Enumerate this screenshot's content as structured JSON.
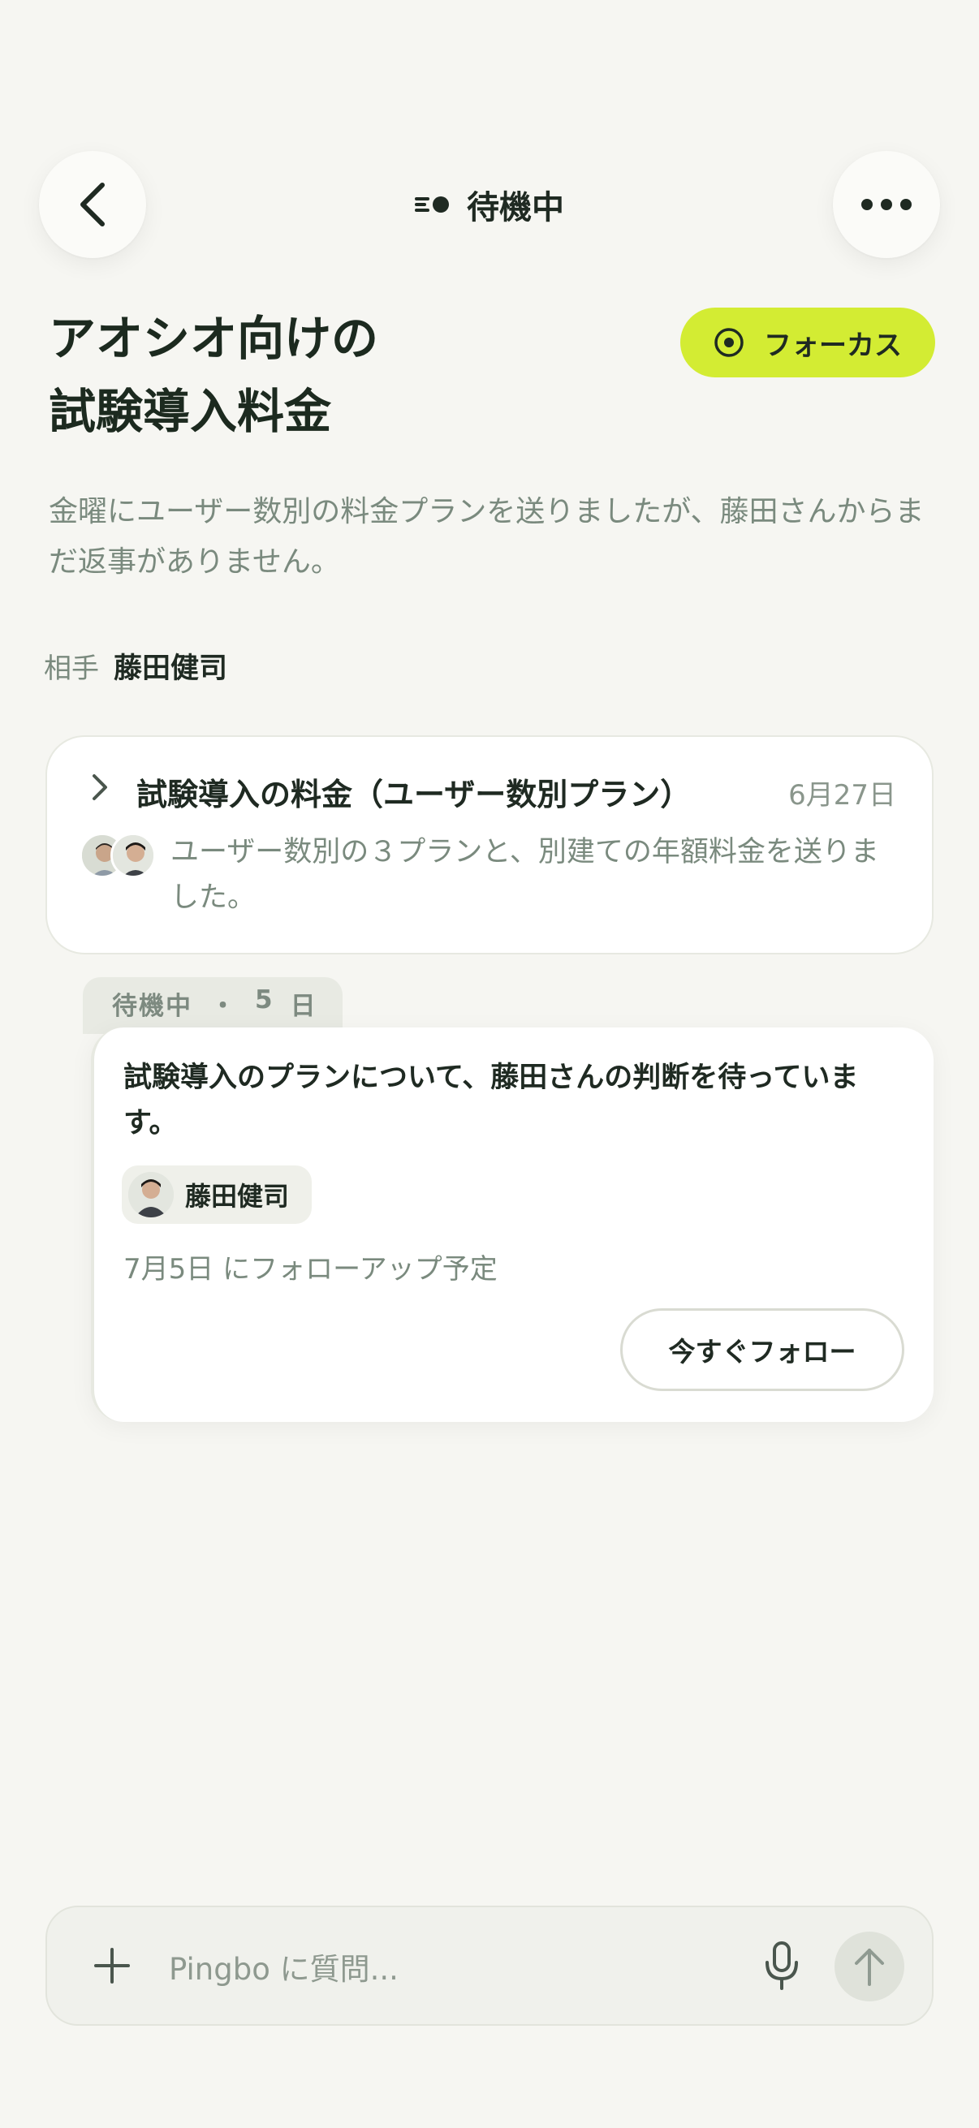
{
  "header": {
    "status_label": "待機中"
  },
  "page": {
    "title_line1": "アオシオ向けの",
    "title_line2": "試験導入料金",
    "focus_label": "フォーカス",
    "description": "金曜にユーザー数別の料金プランを送りましたが、藤田さんからまだ返事がありません。",
    "partner_key": "相手",
    "partner_name": "藤田健司"
  },
  "thread": {
    "title": "試験導入の料金（ユーザー数別プラン）",
    "date": "6月27日",
    "body": "ユーザー数別の３プランと、別建ての年額料金を送りました。"
  },
  "waiting": {
    "tab_status": "待機中",
    "tab_dot": "・",
    "tab_days": "5",
    "tab_unit": "日",
    "text": "試験導入のプランについて、藤田さんの判断を待っています。",
    "person_name": "藤田健司",
    "followup": "7月5日 にフォローアップ予定",
    "follow_button": "今すぐフォロー"
  },
  "input": {
    "placeholder": "Pingbo に質問..."
  },
  "colors": {
    "background": "#f6f6f2",
    "accent": "#d3ec33",
    "text_primary": "#1f2a22",
    "text_muted": "#7a8a7e"
  },
  "icons": [
    "back-chevron-icon",
    "waiting-status-icon",
    "more-dots-icon",
    "focus-target-icon",
    "expand-chevron-icon",
    "plus-icon",
    "microphone-icon",
    "send-arrow-icon"
  ]
}
